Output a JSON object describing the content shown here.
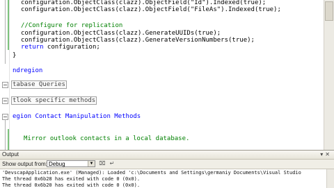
{
  "editor": {
    "lines": {
      "l1": "configuration.ObjectClass(clazz).ObjectField(\"Id\").Indexed(true);",
      "l2": "configuration.ObjectClass(clazz).ObjectField(\"FileAs\").Indexed(true);",
      "l3_comment": "//Configure for replication",
      "l4": "configuration.ObjectClass(clazz).GenerateUUIDs(true);",
      "l5": "configuration.ObjectClass(clazz).GenerateVersionNumbers(true);",
      "l6_kw": "return",
      "l6_rest": " configuration;",
      "l7": "}",
      "l8": "ndregion",
      "l9": "tabase Queries",
      "l10": "tlook specific methods",
      "l11": "egion Contact Manipulation Methods",
      "l12": "Mirror outlook contacts in a local database."
    }
  },
  "output": {
    "title": "Output",
    "show_output_label": "Show output from:",
    "show_output_value": "Debug",
    "lines": [
      "'DevscapApplication.exe' (Managed): Loaded 'c:\\Documents and Settings\\germaniy Documents\\Visual Studio",
      "The thread 0x6b28 has exited with code 0 (0x0).",
      "The thread 0x6b20 has exited with code 0 (0x0)."
    ]
  },
  "icons": [
    "pin-icon",
    "close-icon",
    "dropdown-arrow-icon",
    "clear-all-icon",
    "word-wrap-icon"
  ]
}
